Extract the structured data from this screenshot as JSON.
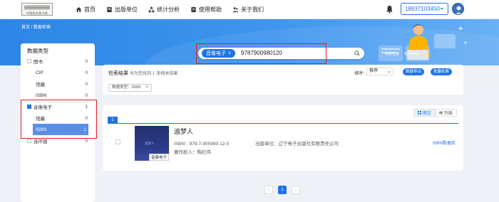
{
  "header": {
    "logo_text": "中国版本图书馆",
    "nav": [
      {
        "label": "首页",
        "icon": "home-icon"
      },
      {
        "label": "出版单位",
        "icon": "book-icon"
      },
      {
        "label": "统计分析",
        "icon": "network-icon"
      },
      {
        "label": "使用帮助",
        "icon": "document-icon"
      },
      {
        "label": "关于我们",
        "icon": "people-icon"
      }
    ],
    "user_phone": "18937103450",
    "accent": "#1e74e6"
  },
  "breadcrumb": {
    "home": "首页",
    "sep": "/",
    "current": "数据检索"
  },
  "search": {
    "type_label": "音像电子",
    "type_caret": "⇅",
    "value": "9787900980120",
    "advanced": "高级检索",
    "history": "检索历史"
  },
  "sidebar": {
    "title": "数据类型",
    "rows": [
      {
        "label": "图书",
        "count": "0"
      },
      {
        "label": "CIP",
        "count": "0"
      },
      {
        "label": "馆藏",
        "count": "0"
      },
      {
        "label": "ISBN",
        "count": "0"
      },
      {
        "label": "音像电子",
        "count": "1"
      },
      {
        "label": "馆藏",
        "count": "0"
      },
      {
        "label": "ISBN",
        "count": "1"
      },
      {
        "label": "连环画",
        "count": "0"
      }
    ]
  },
  "results": {
    "title": "检索结果",
    "summary_prefix": "共为您找到",
    "count": "1",
    "summary_suffix": "条相关结果",
    "sort_label": "排序：",
    "sort_value": "推荐",
    "export_button": "数据导出",
    "batch_button": "批量检索",
    "filter_chip": "数据类型：ISBN",
    "filter_close": "✕"
  },
  "card": {
    "index": "1",
    "view_image": "图文",
    "view_list": "列表",
    "cover_badge": "音像电子",
    "cover_text": "追梦人",
    "title": "追梦人",
    "isbn": "ISBN：978-7-900980-12-0",
    "copyright": "著作权人：陶红伟",
    "publisher": "出版单位：辽宁电子出版社有限责任公司",
    "isbn_link": "ISBN数据库"
  },
  "pager": {
    "prev": "‹",
    "current": "1",
    "next": "›"
  }
}
